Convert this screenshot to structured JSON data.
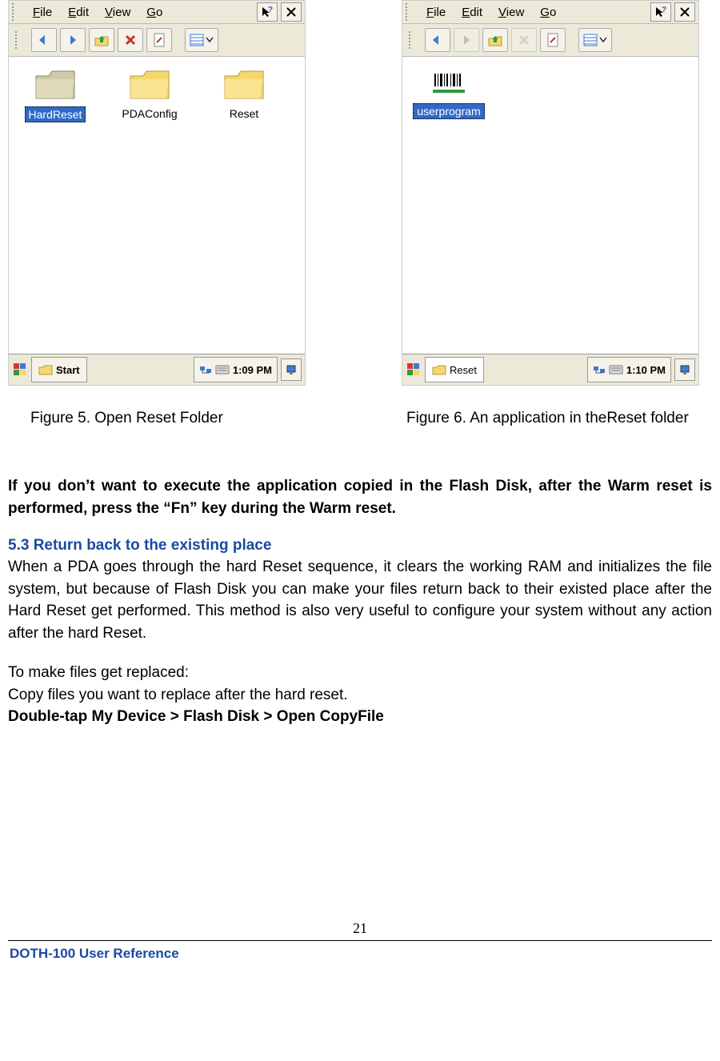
{
  "screens": {
    "left": {
      "menu": [
        "File",
        "Edit",
        "View",
        "Go"
      ],
      "icons": [
        {
          "label": "HardReset",
          "type": "folder",
          "selected": true
        },
        {
          "label": "PDAConfig",
          "type": "folder",
          "selected": false
        },
        {
          "label": "Reset",
          "type": "folder",
          "selected": false
        }
      ],
      "taskbar": {
        "start": "Start",
        "task": "",
        "time": "1:09 PM"
      }
    },
    "right": {
      "menu": [
        "File",
        "Edit",
        "View",
        "Go"
      ],
      "icons": [
        {
          "label": "userprogram",
          "type": "barcode",
          "selected": true
        }
      ],
      "taskbar": {
        "start": "",
        "task": "Reset",
        "time": "1:10 PM"
      }
    }
  },
  "captions": {
    "left": "Figure 5. Open Reset Folder",
    "right": "Figure 6. An application in theReset folder"
  },
  "body": {
    "p1": "If you don’t want to execute the application copied in the Flash Disk, after the Warm reset is performed, press the “Fn” key during the Warm reset.",
    "heading": "5.3 Return back to the existing place",
    "p2": "When a PDA goes through the hard Reset sequence, it clears the working RAM and initializes the file system, but because of Flash Disk you can make your files return back to their existed place after the Hard Reset get performed. This method is also very useful to configure your system without any action after the hard Reset.",
    "p3": "To make files get replaced:",
    "p4": "Copy files you want to replace after the hard reset.",
    "p5": "Double-tap My Device > Flash Disk > Open CopyFile"
  },
  "footer": {
    "page": "21",
    "ref": "DOTH-100 User Reference"
  }
}
